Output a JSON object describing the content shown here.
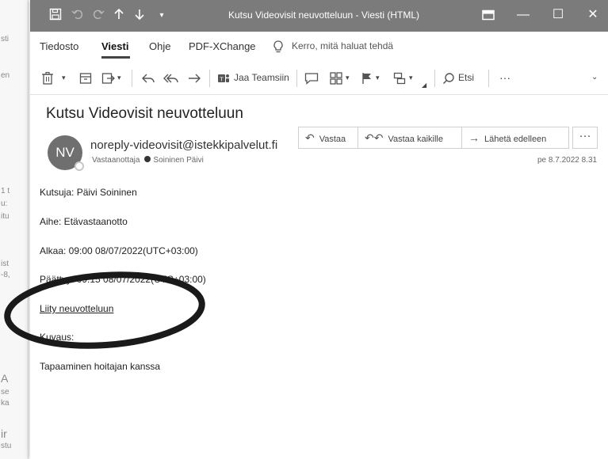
{
  "background_window": {
    "fragments": [
      "sti",
      "en",
      "1 t",
      "u:",
      "itu",
      "ist",
      "-8,",
      "A",
      "se",
      "ka",
      "ir",
      "stu"
    ]
  },
  "titlebar": {
    "title": "Kutsu Videovisit neuvotteluun  -  Viesti (HTML)",
    "icons": [
      "save-icon",
      "undo-icon",
      "redo-icon",
      "up-arrow-icon",
      "down-arrow-icon",
      "customize-icon",
      "ribbon-display-icon",
      "minimize-icon",
      "maximize-icon",
      "close-icon"
    ],
    "minimize_glyph": "—",
    "maximize_glyph": "☐",
    "close_glyph": "✕"
  },
  "menu": {
    "items": [
      "Tiedosto",
      "Viesti",
      "Ohje",
      "PDF-XChange"
    ],
    "tellme": "Kerro, mitä haluat tehdä"
  },
  "ribbon": {
    "teams_label": "Jaa Teamsiin",
    "search_label": "Etsi",
    "more_glyph": "···"
  },
  "message": {
    "subject": "Kutsu Videovisit neuvotteluun",
    "avatar_initials": "NV",
    "sender": "noreply-videovisit@istekkipalvelut.fi",
    "recipient_prefix": "Vastaanottaja",
    "recipient": "Soininen Päivi",
    "date": "pe 8.7.2022 8.31",
    "actions": {
      "reply": "Vastaa",
      "reply_all": "Vastaa kaikille",
      "forward": "Lähetä edelleen",
      "more": "···"
    }
  },
  "body": {
    "inviter": "Kutsuja: Päivi Soininen",
    "topic": "Aihe: Etävastaanotto",
    "start": "Alkaa: 09:00 08/07/2022(UTC+03:00)",
    "end": "Päättyy: 09:15 08/07/2022(UTC+03:00)",
    "join_link": "Liity neuvotteluun",
    "description_label": "Kuvaus:",
    "description": "Tapaaminen hoitajan kanssa"
  }
}
